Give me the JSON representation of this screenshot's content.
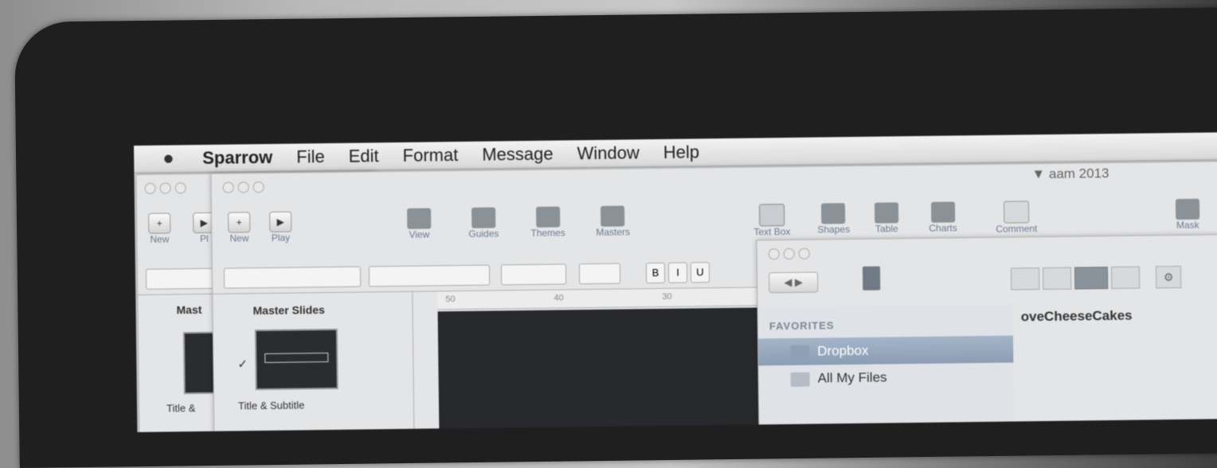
{
  "menubar": {
    "apple": "",
    "app": "Sparrow",
    "items": [
      "File",
      "Edit",
      "Format",
      "Message",
      "Window",
      "Help"
    ]
  },
  "status": {
    "clock": "aam 2013"
  },
  "keynote_back": {
    "new_label": "New",
    "partial_label": "Pl",
    "sidebar_header": "Mast",
    "thumb_caption": "Title &"
  },
  "keynote_front": {
    "toolbar": {
      "new_label": "New",
      "play_label": "Play",
      "view_label": "View",
      "guides_label": "Guides",
      "themes_label": "Themes",
      "masters_label": "Masters",
      "textbox_label": "Text Box",
      "shapes_label": "Shapes",
      "table_label": "Table",
      "charts_label": "Charts",
      "comment_label": "Comment",
      "mask_label": "Mask"
    },
    "format_buttons": [
      "B",
      "I",
      "U"
    ],
    "sidebar_header": "Master Slides",
    "thumb_caption": "Title & Subtitle",
    "ruler": [
      "50",
      "40",
      "30"
    ]
  },
  "finder": {
    "folder_title": "oveCheeseCakes",
    "favorites_header": "FAVORITES",
    "items": [
      {
        "label": "Dropbox",
        "selected": true
      },
      {
        "label": "All My Files",
        "selected": false
      }
    ]
  }
}
